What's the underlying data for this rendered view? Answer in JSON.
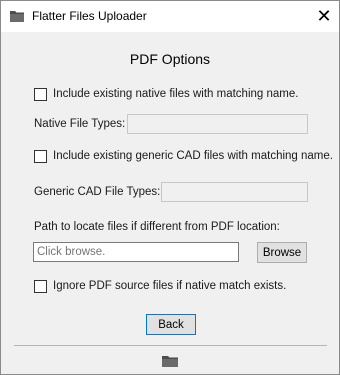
{
  "window": {
    "title": "Flatter Files Uploader",
    "close_glyph": "✕"
  },
  "form": {
    "heading": "PDF Options",
    "native_checkbox_label": "Include existing native files with matching name.",
    "native_types_label": "Native File Types:",
    "native_types_value": "",
    "cad_checkbox_label": "Include existing generic CAD files with matching name.",
    "cad_types_label": "Generic CAD File Types:",
    "cad_types_value": "",
    "path_label": "Path to locate files if different from PDF location:",
    "path_placeholder": "Click browse.",
    "browse_label": "Browse",
    "ignore_checkbox_label": "Ignore PDF source files if native match exists.",
    "back_label": "Back"
  },
  "checkbox_states": {
    "include_native": false,
    "include_cad": false,
    "ignore_pdf": false
  },
  "icons": {
    "title": "folder-icon",
    "footer": "folder-icon"
  },
  "colors": {
    "focus_border": "#0078d7",
    "folder": "#5a5a5a"
  }
}
